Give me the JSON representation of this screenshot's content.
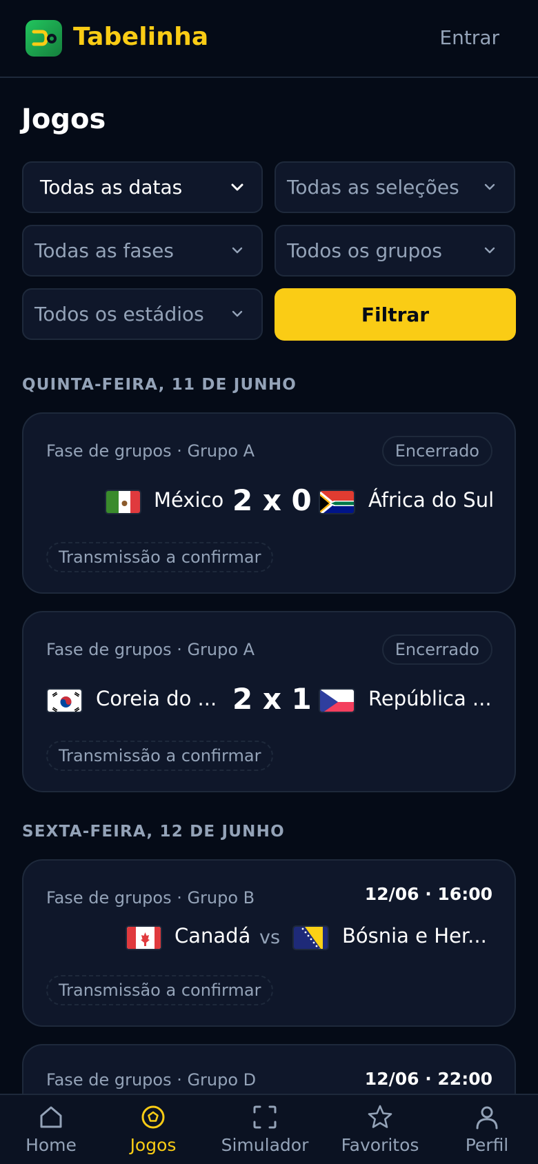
{
  "app": {
    "name": "Tabelinha",
    "login_label": "Entrar",
    "accent_color": "#facc15",
    "brand_color": "#22c55e"
  },
  "page": {
    "title": "Jogos"
  },
  "filters": {
    "date": "Todas as datas",
    "teams": "Todas as seleções",
    "phases": "Todas as fases",
    "groups": "Todos os grupos",
    "stadiums": "Todos os estádios",
    "submit_label": "Filtrar"
  },
  "days": [
    {
      "heading": "QUINTA-FEIRA, 11 DE JUNHO",
      "matches": [
        {
          "phase": "Fase de grupos · Grupo A",
          "status": "Encerrado",
          "home": {
            "name": "México",
            "flag": "mexico-flag"
          },
          "away": {
            "name": "África do Sul",
            "flag": "south-africa-flag"
          },
          "score": "2 x 0",
          "broadcast": "Transmissão a confirmar"
        },
        {
          "phase": "Fase de grupos · Grupo A",
          "status": "Encerrado",
          "home": {
            "name": "Coreia do ...",
            "flag": "south-korea-flag"
          },
          "away": {
            "name": "República ...",
            "flag": "czech-republic-flag"
          },
          "score": "2 x 1",
          "broadcast": "Transmissão a confirmar"
        }
      ]
    },
    {
      "heading": "SEXTA-FEIRA, 12 DE JUNHO",
      "matches": [
        {
          "phase": "Fase de grupos · Grupo B",
          "time": "12/06 · 16:00",
          "home": {
            "name": "Canadá",
            "flag": "canada-flag"
          },
          "away": {
            "name": "Bósnia e Her...",
            "flag": "bosnia-flag"
          },
          "vs": "vs",
          "broadcast": "Transmissão a confirmar"
        },
        {
          "phase": "Fase de grupos · Grupo D",
          "time": "12/06 · 22:00"
        }
      ]
    }
  ],
  "bottom_nav": [
    {
      "label": "Home",
      "icon": "home-icon"
    },
    {
      "label": "Jogos",
      "icon": "soccer-ball-icon",
      "active": true
    },
    {
      "label": "Simulador",
      "icon": "scan-frame-icon"
    },
    {
      "label": "Favoritos",
      "icon": "star-icon"
    },
    {
      "label": "Perfil",
      "icon": "user-icon"
    }
  ]
}
